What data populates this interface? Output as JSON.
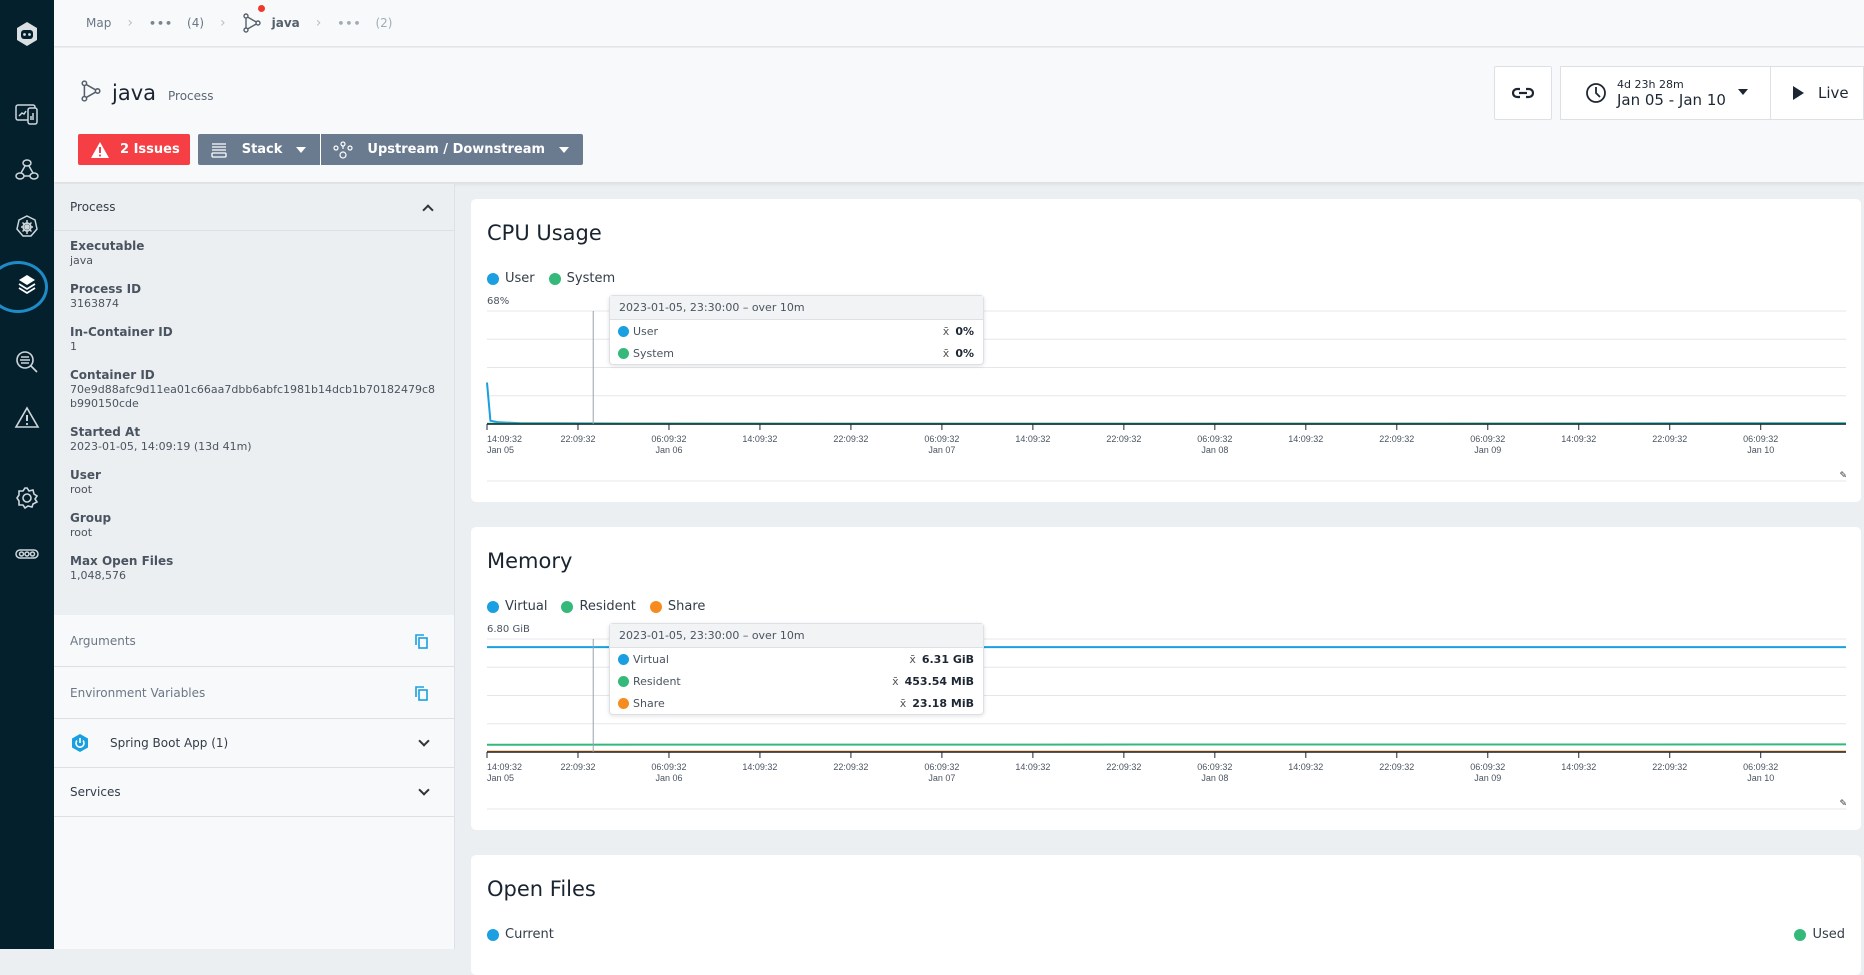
{
  "breadcrumb": {
    "items": [
      {
        "label": "Map"
      },
      {
        "label": "•••",
        "count": "(4)"
      },
      {
        "label": "java"
      },
      {
        "label": "•••",
        "count": "(2)"
      }
    ]
  },
  "header": {
    "title": "java",
    "subtitle": "Process",
    "issues_label": "2 Issues",
    "stack_label": "Stack",
    "updown_label": "Upstream / Downstream",
    "time_range_duration": "4d 23h 28m",
    "time_range_label": "Jan 05 - Jan 10",
    "live_label": "Live"
  },
  "nav": {
    "items": [
      "logo",
      "dashboards",
      "map",
      "kubernetes",
      "stack",
      "search",
      "alerts",
      "settings",
      "more"
    ],
    "active": "stack"
  },
  "sidebar": {
    "process_section": "Process",
    "props": [
      {
        "label": "Executable",
        "value": "java"
      },
      {
        "label": "Process ID",
        "value": "3163874"
      },
      {
        "label": "In-Container ID",
        "value": "1"
      },
      {
        "label": "Container ID",
        "value": "70e9d88afc9d11ea01c66aa7dbb6abfc1981b14dcb1b70182479c8b990150cde"
      },
      {
        "label": "Started At",
        "value": "2023-01-05, 14:09:19 (13d 41m)"
      },
      {
        "label": "User",
        "value": "root"
      },
      {
        "label": "Group",
        "value": "root"
      },
      {
        "label": "Max Open Files",
        "value": "1,048,576"
      }
    ],
    "arguments_label": "Arguments",
    "env_label": "Environment Variables",
    "spring_label": "Spring Boot App (1)",
    "services_label": "Services"
  },
  "colors": {
    "blue": "#1a9fe0",
    "green": "#35b97a",
    "orange": "#f68c1f",
    "issues_red": "#f53f45",
    "button_gray": "#6a7a8f",
    "nav_bg": "#04202c"
  },
  "x_ticks": [
    {
      "t": "14:09:32",
      "d": "Jan 05"
    },
    {
      "t": "22:09:32",
      "d": ""
    },
    {
      "t": "06:09:32",
      "d": "Jan 06"
    },
    {
      "t": "14:09:32",
      "d": ""
    },
    {
      "t": "22:09:32",
      "d": ""
    },
    {
      "t": "06:09:32",
      "d": "Jan 07"
    },
    {
      "t": "14:09:32",
      "d": ""
    },
    {
      "t": "22:09:32",
      "d": ""
    },
    {
      "t": "06:09:32",
      "d": "Jan 08"
    },
    {
      "t": "14:09:32",
      "d": ""
    },
    {
      "t": "22:09:32",
      "d": ""
    },
    {
      "t": "06:09:32",
      "d": "Jan 09"
    },
    {
      "t": "14:09:32",
      "d": ""
    },
    {
      "t": "22:09:32",
      "d": ""
    },
    {
      "t": "06:09:32",
      "d": "Jan 10"
    }
  ],
  "chart_data": [
    {
      "type": "line",
      "title": "CPU Usage",
      "ymax_label": "68%",
      "ylim": [
        0,
        68
      ],
      "x_hours_range": [
        0,
        119.5
      ],
      "legend": [
        "User",
        "System"
      ],
      "series": [
        {
          "name": "User",
          "color": "#1a9fe0",
          "points": [
            [
              0,
              25
            ],
            [
              0.3,
              2
            ],
            [
              1,
              1
            ],
            [
              3,
              0.5
            ],
            [
              6,
              0.4
            ],
            [
              12,
              0.3
            ],
            [
              30,
              0.2
            ],
            [
              60,
              0.2
            ],
            [
              90,
              0.3
            ],
            [
              110,
              0.5
            ],
            [
              119.5,
              0.5
            ]
          ]
        },
        {
          "name": "System",
          "color": "#35b97a",
          "points": [
            [
              0,
              0.2
            ],
            [
              119.5,
              0.2
            ]
          ]
        }
      ],
      "tooltip": {
        "header": "2023-01-05, 23:30:00 – over 10m",
        "rows": [
          {
            "name": "User",
            "value": "0%"
          },
          {
            "name": "System",
            "value": "0%"
          }
        ]
      },
      "cursor_hours": 9.34
    },
    {
      "type": "line",
      "title": "Memory",
      "ymax_label": "6.80 GiB",
      "ylim": [
        0,
        6.8
      ],
      "x_hours_range": [
        0,
        119.5
      ],
      "legend": [
        "Virtual",
        "Resident",
        "Share"
      ],
      "series": [
        {
          "name": "Virtual",
          "color": "#1a9fe0",
          "points": [
            [
              0,
              6.31
            ],
            [
              119.5,
              6.31
            ]
          ]
        },
        {
          "name": "Resident",
          "color": "#35b97a",
          "points": [
            [
              0,
              0.44
            ],
            [
              119.5,
              0.46
            ]
          ]
        },
        {
          "name": "Share",
          "color": "#f68c1f",
          "points": [
            [
              0,
              0.023
            ],
            [
              119.5,
              0.023
            ]
          ]
        }
      ],
      "tooltip": {
        "header": "2023-01-05, 23:30:00 – over 10m",
        "rows": [
          {
            "name": "Virtual",
            "value": "6.31 GiB"
          },
          {
            "name": "Resident",
            "value": "453.54 MiB"
          },
          {
            "name": "Share",
            "value": "23.18 MiB"
          }
        ]
      },
      "cursor_hours": 9.34
    },
    {
      "type": "line",
      "title": "Open Files",
      "legend": [
        "Current",
        "Used"
      ]
    }
  ]
}
